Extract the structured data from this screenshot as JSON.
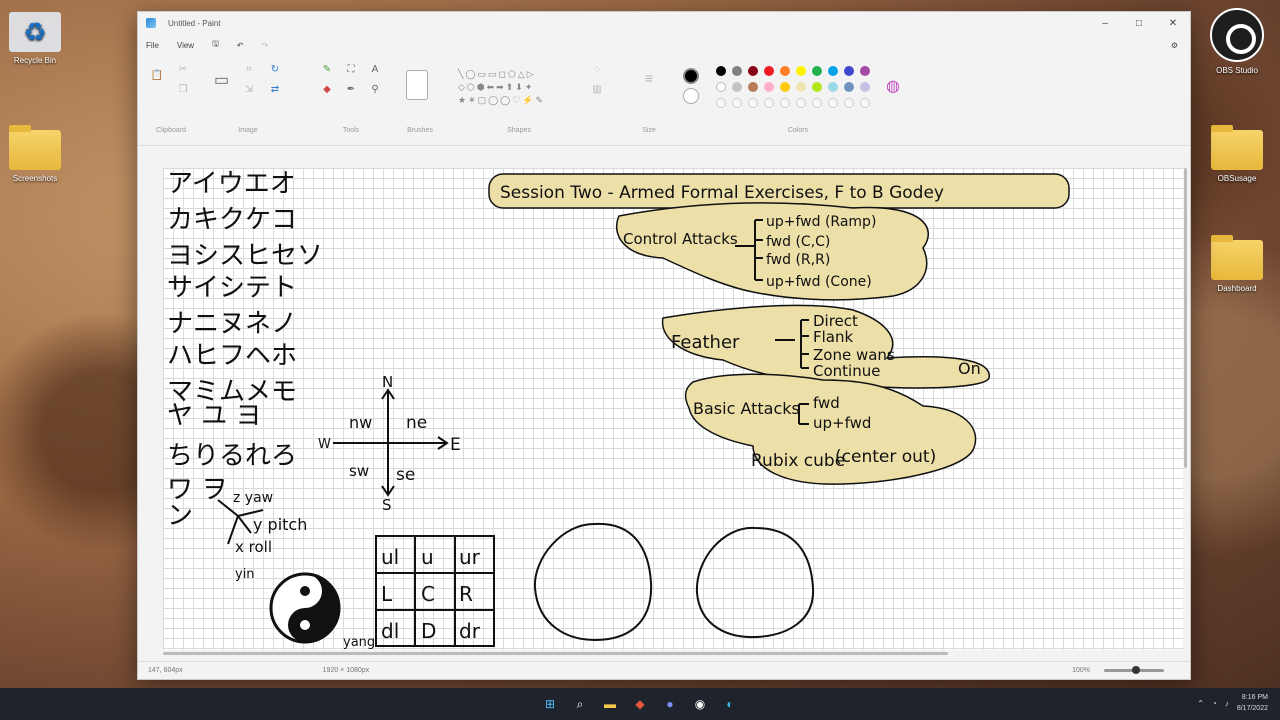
{
  "window": {
    "title": "Untitled - Paint",
    "minimize": "–",
    "maximize": "□",
    "close": "✕"
  },
  "menu": {
    "file": "File",
    "view": "View"
  },
  "ribbon": {
    "groups": {
      "clipboard": "Clipboard",
      "image": "Image",
      "tools": "Tools",
      "brushes": "Brushes",
      "shapes": "Shapes",
      "size": "Size",
      "colors": "Colors"
    },
    "shapes_row1": "╲◯▭▭◻⬠△▷",
    "shapes_row2": "◇⬡⬢⬅➡⬆⬇✦",
    "shapes_row3": "★✶▢◯◯♡⚡✎",
    "primary_color": "#000000",
    "secondary_color": "#ffffff",
    "palette_row1": [
      "#000000",
      "#7f7f7f",
      "#880015",
      "#ed1c24",
      "#ff7f27",
      "#fff200",
      "#22b14c",
      "#00a2e8",
      "#3f48cc",
      "#a349a4"
    ],
    "palette_row2": [
      "#ffffff",
      "#c3c3c3",
      "#b97a57",
      "#ffaec9",
      "#ffc90e",
      "#efe4b0",
      "#b5e61d",
      "#99d9ea",
      "#7092be",
      "#c8bfe7"
    ]
  },
  "canvas": {
    "katakana_rows": [
      "アイウエオ",
      "カキクケコ",
      "ヨシスヒセソ",
      "サイシテト",
      "ナニヌネノ",
      "ハヒフヘホ",
      "マミムメモ",
      "ヤ ユ ヨ",
      "ちりるれろ",
      "ワ ヲ",
      "ン"
    ],
    "ypr_labels": [
      "z yaw",
      "y pitch",
      "x roll"
    ],
    "yin_label": "yin",
    "yang_label": "yang",
    "compass": {
      "n": "N",
      "s": "S",
      "e": "E",
      "w": "W",
      "nw": "nw",
      "ne": "ne",
      "sw": "sw",
      "se": "se"
    },
    "grid_cells": [
      "ul",
      "u",
      "ur",
      "L",
      "C",
      "R",
      "dl",
      "D",
      "dr"
    ],
    "mindmap": {
      "title": "Session Two - Armed Formal Exercises, F to B Godey",
      "control_attacks": "Control Attacks",
      "control_items": [
        "up+fwd (Ramp)",
        "fwd (C,C)",
        "fwd (R,R)",
        "up+fwd (Cone)"
      ],
      "feather": "Feather",
      "feather_items": [
        "Direct",
        "Flank",
        "Zone wans",
        "Continue"
      ],
      "feather_extra": "On",
      "basic_attacks": "Basic Attacks",
      "basic_items": [
        "fwd",
        "up+fwd"
      ],
      "rubix": "Rubix cube",
      "rubix_note": "(center out)"
    }
  },
  "status": {
    "cursor": "147, 604px",
    "selection": "",
    "size": "1920 × 1080px",
    "zoom": "100%"
  },
  "desktop": {
    "recycle": "Recycle Bin",
    "folder1": "Screenshots",
    "obs": "OBS Studio",
    "folder2": "OBSusage",
    "folder3": "Dashboard"
  },
  "taskbar": {
    "time": "8:16 PM",
    "date": "8/17/2022"
  }
}
